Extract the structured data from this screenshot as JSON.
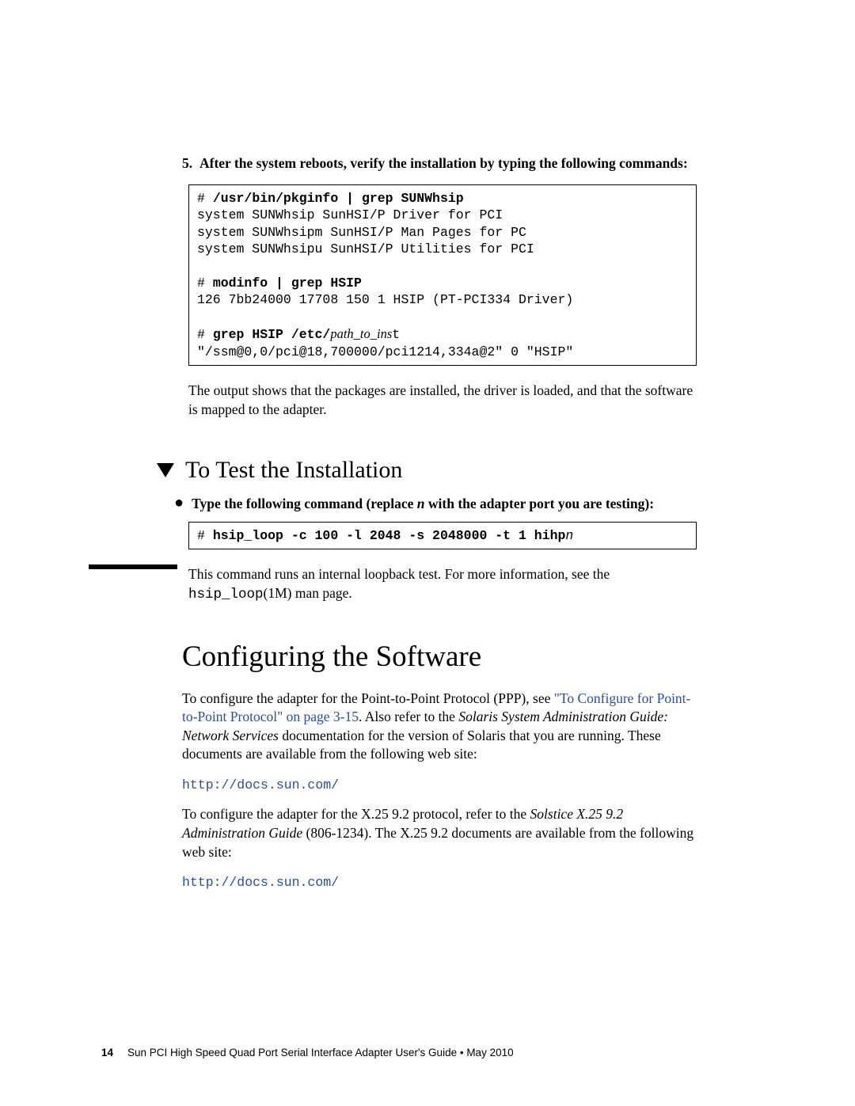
{
  "step5": {
    "num": "5.",
    "text": "After the system reboots, verify the installation by typing the following commands:"
  },
  "code1": {
    "l1a": "# ",
    "l1b": "/usr/bin/pkginfo | grep SUNWhsip",
    "l2": "system SUNWhsip SunHSI/P Driver for PCI",
    "l3": "system SUNWhsipm SunHSI/P Man Pages for PC",
    "l4": "system SUNWhsipu SunHSI/P Utilities for PCI",
    "l5a": "# ",
    "l5b": "modinfo | grep HSIP",
    "l6": "126 7bb24000 17708 150 1 HSIP (PT-PCI334 Driver)",
    "l7a": "# ",
    "l7b": "grep HSIP /etc/",
    "l7c": "path_to_ins",
    "l7d": "t",
    "l8": "\"/ssm@0,0/pci@18,700000/pci1214,334a@2\" 0 \"HSIP\""
  },
  "para1": "The output shows that the packages are installed, the driver is loaded, and that the software is mapped to the adapter.",
  "h2": "To Test the Installation",
  "bullet1": {
    "a": "Type the following command (replace ",
    "n": "n",
    "b": " with the adapter port you are testing):"
  },
  "code2": {
    "a": "# ",
    "b": "hsip_loop -c 100 -l 2048 -s 2048000 -t 1 hihp",
    "c": "n"
  },
  "para2": {
    "a": "This command runs an internal loopback test. For more information, see the ",
    "b": "hsip_loop",
    "c": "(1M) man page."
  },
  "h1": "Configuring the Software",
  "para3": {
    "a": "To configure the adapter for the Point-to-Point Protocol (PPP), see ",
    "link": "\"To Configure for Point-to-Point Protocol\" on page 3-15",
    "b": ". Also refer to the ",
    "ital": "Solaris System Administration Guide: Network Services",
    "c": " documentation for the version of Solaris that you are running. These documents are available from the following web site:"
  },
  "url1": "http://docs.sun.com/",
  "para4": {
    "a": "To configure the adapter for the X.25 9.2 protocol, refer to the ",
    "ital": "Solstice X.25 9.2 Administration Guide",
    "b": " (806-1234). The X.25 9.2 documents are available from the following web site:"
  },
  "url2": "http://docs.sun.com/",
  "footer": {
    "page": "14",
    "text": "Sun PCI High Speed Quad Port Serial Interface Adapter User's Guide  •  May 2010"
  }
}
